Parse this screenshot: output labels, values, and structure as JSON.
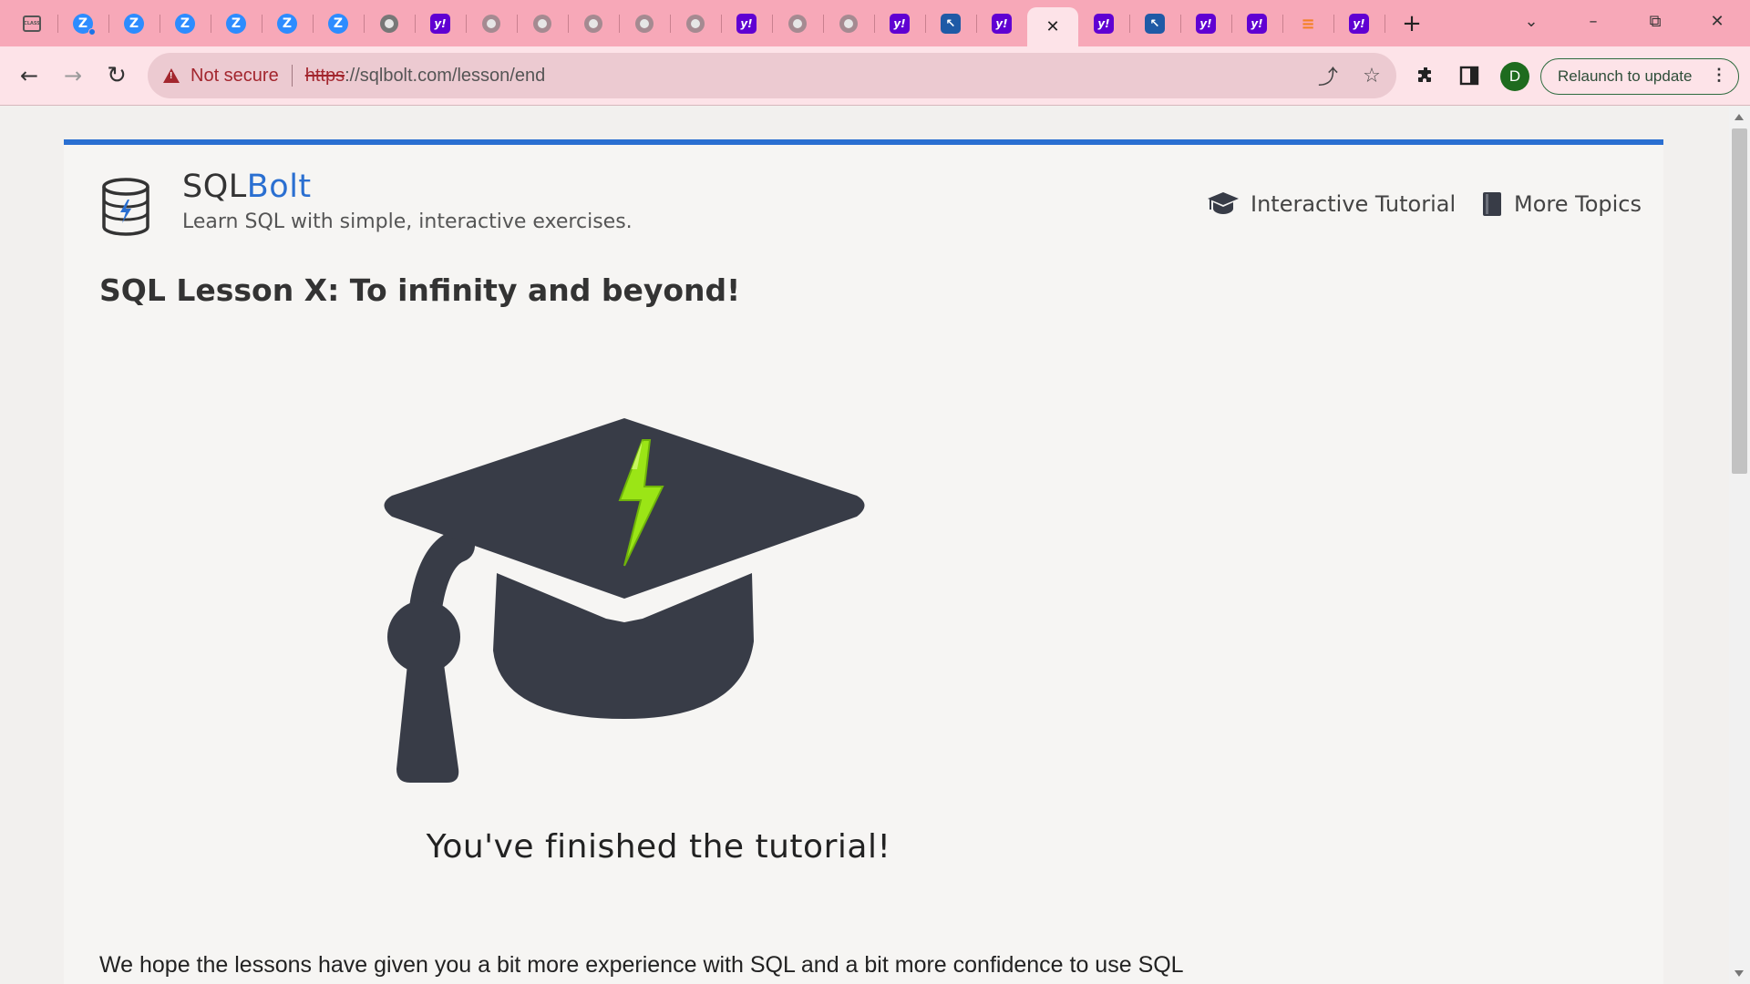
{
  "tabs": [
    {
      "icon": "classroom-icon"
    },
    {
      "icon": "zoom-icon",
      "badge": true
    },
    {
      "icon": "zoom-icon"
    },
    {
      "icon": "zoom-icon"
    },
    {
      "icon": "zoom-icon"
    },
    {
      "icon": "zoom-icon"
    },
    {
      "icon": "zoom-icon"
    },
    {
      "icon": "globe-icon"
    },
    {
      "icon": "yahoo-icon"
    },
    {
      "icon": "globe-icon"
    },
    {
      "icon": "globe-icon"
    },
    {
      "icon": "globe-icon"
    },
    {
      "icon": "globe-icon"
    },
    {
      "icon": "globe-icon"
    },
    {
      "icon": "yahoo-icon"
    },
    {
      "icon": "globe-icon"
    },
    {
      "icon": "globe-icon"
    },
    {
      "icon": "yahoo-icon"
    },
    {
      "icon": "cursor-icon"
    },
    {
      "icon": "yahoo-icon"
    },
    {
      "icon": "close-icon",
      "active": true
    },
    {
      "icon": "yahoo-icon"
    },
    {
      "icon": "cursor-icon"
    },
    {
      "icon": "yahoo-icon"
    },
    {
      "icon": "yahoo-icon"
    },
    {
      "icon": "stackoverflow-icon"
    },
    {
      "icon": "yahoo-icon"
    }
  ],
  "toolbar": {
    "security_label": "Not secure",
    "url_scheme": "https",
    "url_rest": "://sqlbolt.com/lesson/end",
    "profile_initial": "D",
    "relaunch_label": "Relaunch to update"
  },
  "site": {
    "brand_main": "SQL",
    "brand_accent": "Bolt",
    "tagline": "Learn SQL with simple, interactive exercises.",
    "nav": [
      {
        "label": "Interactive Tutorial",
        "icon": "graduation-cap-icon"
      },
      {
        "label": "More Topics",
        "icon": "book-icon"
      }
    ]
  },
  "lesson": {
    "title": "SQL Lesson X: To infinity and beyond!",
    "hero_icon": "graduation-cap-bolt-icon",
    "finished_message": "You've finished the tutorial!",
    "body": "We hope the lessons have given you a bit more experience with SQL and a bit more confidence to use SQL"
  },
  "colors": {
    "tabstrip": "#f7a8b8",
    "toolbar": "#fde3e8",
    "accent_blue": "#2a6fd1",
    "bolt_green": "#9be516",
    "cap_dark": "#383c47"
  }
}
